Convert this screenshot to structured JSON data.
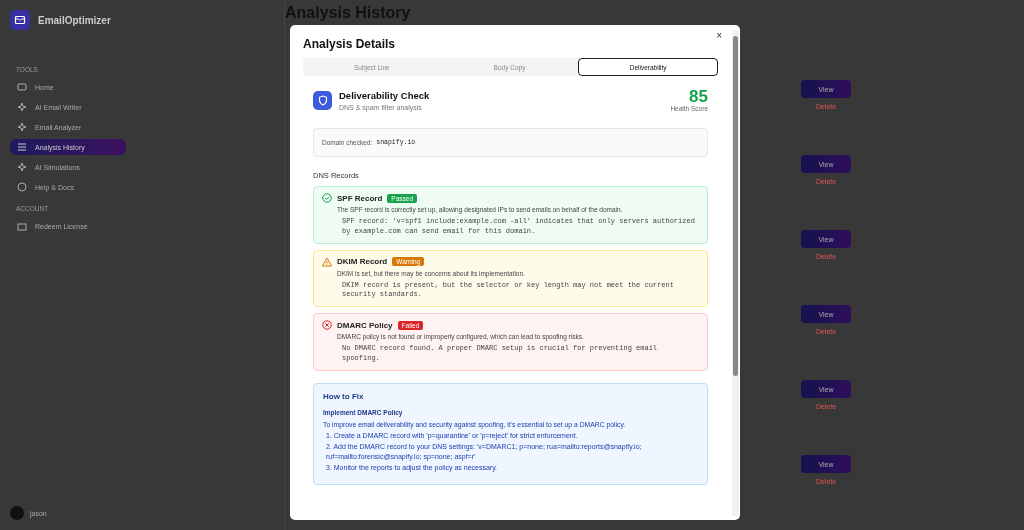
{
  "sidebar": {
    "brand": "EmailOptimizer",
    "sections": [
      {
        "heading": "TOOLS",
        "items": [
          {
            "label": "Home",
            "selected": false
          },
          {
            "label": "AI Email Writer",
            "selected": false
          },
          {
            "label": "Email Analyzer",
            "selected": false
          },
          {
            "label": "Analysis History",
            "selected": true
          },
          {
            "label": "AI Simulations",
            "selected": false
          },
          {
            "label": "Help & Docs",
            "selected": false
          }
        ]
      },
      {
        "heading": "ACCOUNT",
        "items": [
          {
            "label": "Redeem License",
            "selected": false
          }
        ]
      }
    ],
    "user": {
      "name": "jason"
    }
  },
  "page": {
    "title": "Analysis History",
    "rows": [
      {
        "view": "View",
        "delete": "Delete"
      },
      {
        "view": "View",
        "delete": "Delete"
      },
      {
        "view": "View",
        "delete": "Delete"
      },
      {
        "view": "View",
        "delete": "Delete"
      },
      {
        "view": "View",
        "delete": "Delete"
      },
      {
        "view": "View",
        "delete": "Delete"
      }
    ]
  },
  "modal": {
    "title": "Analysis Details",
    "close": "×",
    "tabs": [
      {
        "label": "Subject Line",
        "selected": false
      },
      {
        "label": "Body Copy",
        "selected": false
      },
      {
        "label": "Deliverability",
        "selected": true
      }
    ],
    "header": {
      "title": "Deliverability Check",
      "subtitle": "DNS & spam filter analysis",
      "score": "85",
      "score_label": "Health Score"
    },
    "domain": {
      "label": "Domain checked:",
      "value": "snapify.io"
    },
    "section_title": "DNS Records",
    "records": [
      {
        "kind": "passed",
        "name": "SPF Record",
        "badge": "Passed",
        "description": "The SPF record is correctly set up, allowing designated IPs to send emails on behalf of the domain.",
        "detail": "SPF record: 'v=spf1 include:example.com -all' indicates that only servers authorized by example.com can send email for this domain."
      },
      {
        "kind": "warning",
        "name": "DKIM Record",
        "badge": "Warning",
        "description": "DKIM is set, but there may be concerns about its implementation.",
        "detail": "DKIM record is present, but the selector or key length may not meet the current security standards."
      },
      {
        "kind": "failed",
        "name": "DMARC Policy",
        "badge": "Failed",
        "description": "DMARC policy is not found or improperly configured, which can lead to spoofing risks.",
        "detail": "No DMARC record found. A proper DMARC setup is crucial for preventing email spoofing."
      }
    ],
    "fix": {
      "title": "How to Fix",
      "subtitle": "Implement DMARC Policy",
      "intro": "To improve email deliverability and security against spoofing, it's essential to set up a DMARC policy.",
      "steps": [
        "1. Create a DMARC record with 'p=quarantine' or 'p=reject' for strict enforcement.",
        "2. Add the DMARC record to your DNS settings: 'v=DMARC1; p=none; rua=mailto:reports@snapify.io; ruf=mailto:forensic@snapify.io; sp=none; aspf=r'",
        "3. Monitor the reports to adjust the policy as necessary."
      ]
    }
  }
}
